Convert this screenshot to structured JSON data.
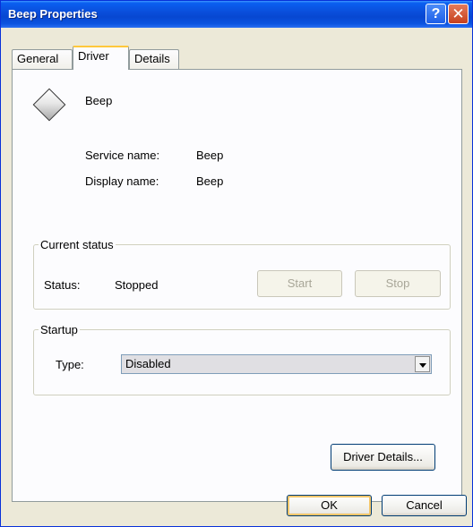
{
  "window": {
    "title": "Beep Properties",
    "help_icon": "?",
    "close_icon": "✕"
  },
  "tabs": [
    {
      "label": "General",
      "active": false
    },
    {
      "label": "Driver",
      "active": true
    },
    {
      "label": "Details",
      "active": false
    }
  ],
  "device": {
    "icon": "generic-device-icon",
    "name": "Beep"
  },
  "service": {
    "service_name_label": "Service name:",
    "service_name_value": "Beep",
    "display_name_label": "Display name:",
    "display_name_value": "Beep"
  },
  "current_status": {
    "legend": "Current status",
    "status_label": "Status:",
    "status_value": "Stopped",
    "start_button": "Start",
    "stop_button": "Stop"
  },
  "startup": {
    "legend": "Startup",
    "type_label": "Type:",
    "type_value": "Disabled"
  },
  "driver_details_button": "Driver Details...",
  "footer": {
    "ok_button": "OK",
    "cancel_button": "Cancel"
  }
}
